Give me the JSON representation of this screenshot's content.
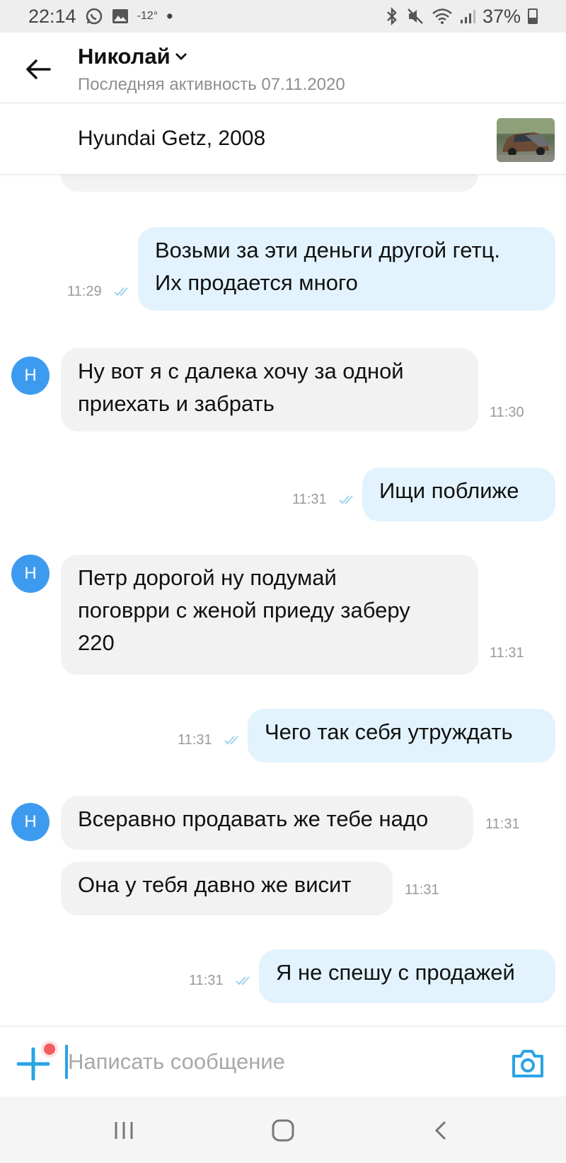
{
  "status_bar": {
    "time": "22:14",
    "temperature": "-12°",
    "dot": "•",
    "battery": "37%"
  },
  "header": {
    "name": "Николай",
    "last_active": "Последняя активность 07.11.2020"
  },
  "listing": {
    "title": "Hyundai Getz, 2008"
  },
  "messages": [
    {
      "side": "out",
      "text_lines": [
        "Возьми за эти деньги другой гетц.",
        "Их продается много"
      ],
      "time": "11:29"
    },
    {
      "side": "in",
      "avatar": "Н",
      "text_lines": [
        "Ну вот я с далека хочу за одной",
        "приехать и забрать"
      ],
      "time": "11:30"
    },
    {
      "side": "out",
      "text_lines": [
        "Ищи поближе"
      ],
      "time": "11:31"
    },
    {
      "side": "in",
      "avatar": "Н",
      "text_lines": [
        "Петр дорогой ну подумай",
        "поговрри с женой приеду заберу",
        "220"
      ],
      "time": "11:31"
    },
    {
      "side": "out",
      "text_lines": [
        "Чего так себя утруждать"
      ],
      "time": "11:31"
    },
    {
      "side": "in",
      "avatar": "Н",
      "text_lines": [
        "Всеравно продавать же тебе надо"
      ],
      "time": "11:31"
    },
    {
      "side": "in",
      "text_lines": [
        "Она у тебя давно же висит"
      ],
      "time": "11:31"
    },
    {
      "side": "out",
      "text_lines": [
        "Я не спешу с продажей"
      ],
      "time": "11:31"
    }
  ],
  "input": {
    "placeholder": "Написать сообщение"
  },
  "icons": {
    "back": "arrow-left-icon",
    "dropdown": "chevron-down-icon",
    "attach": "plus-icon",
    "camera": "camera-icon",
    "read": "double-check-icon",
    "nav": [
      "recent-apps-icon",
      "home-icon",
      "back-icon"
    ]
  },
  "colors": {
    "accent": "#2aa4e5",
    "avatar": "#3d9bef",
    "outgoing_bubble": "#e2f3fd",
    "incoming_bubble": "#f2f2f2",
    "notification_dot": "#f35d5d"
  }
}
